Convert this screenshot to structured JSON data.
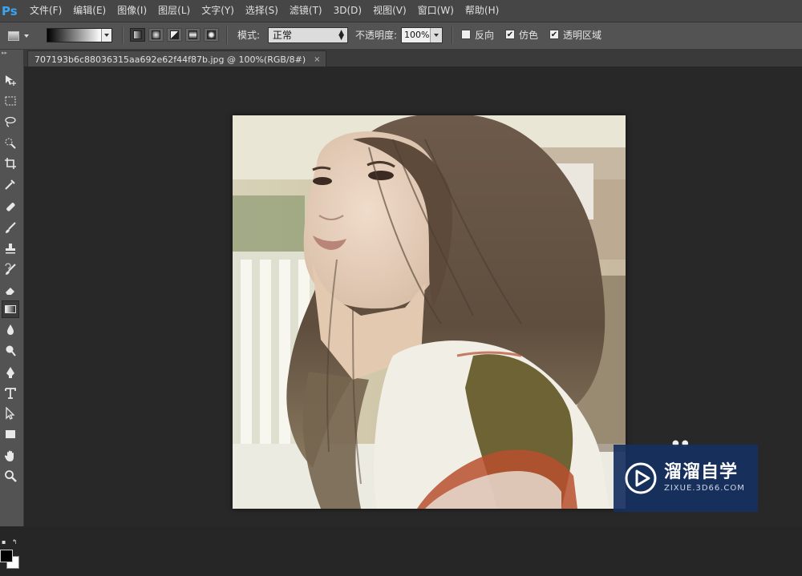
{
  "app": {
    "logo": "Ps"
  },
  "menu": [
    "文件(F)",
    "编辑(E)",
    "图像(I)",
    "图层(L)",
    "文字(Y)",
    "选择(S)",
    "滤镜(T)",
    "3D(D)",
    "视图(V)",
    "窗口(W)",
    "帮助(H)"
  ],
  "options": {
    "mode_label": "模式:",
    "mode_value": "正常",
    "opacity_label": "不透明度:",
    "opacity_value": "100%",
    "reverse_label": "反向",
    "reverse_checked": false,
    "dither_label": "仿色",
    "dither_checked": true,
    "transparency_label": "透明区域",
    "transparency_checked": true,
    "gradient_types": [
      "linear",
      "radial",
      "angle",
      "reflected",
      "diamond"
    ],
    "active_gradient_type": "linear"
  },
  "tools": [
    {
      "name": "move-tool-icon"
    },
    {
      "name": "marquee-tool-icon"
    },
    {
      "name": "lasso-tool-icon"
    },
    {
      "name": "quick-select-tool-icon"
    },
    {
      "name": "crop-tool-icon"
    },
    {
      "name": "eyedropper-tool-icon"
    },
    {
      "name": "healing-brush-tool-icon"
    },
    {
      "name": "brush-tool-icon"
    },
    {
      "name": "clone-stamp-tool-icon"
    },
    {
      "name": "history-brush-tool-icon"
    },
    {
      "name": "eraser-tool-icon"
    },
    {
      "name": "gradient-tool-icon",
      "active": true
    },
    {
      "name": "blur-tool-icon"
    },
    {
      "name": "dodge-tool-icon"
    },
    {
      "name": "pen-tool-icon"
    },
    {
      "name": "type-tool-icon"
    },
    {
      "name": "path-selection-tool-icon"
    },
    {
      "name": "rectangle-tool-icon"
    },
    {
      "name": "hand-tool-icon"
    },
    {
      "name": "zoom-tool-icon"
    }
  ],
  "colors": {
    "foreground": "#000000",
    "background": "#ffffff"
  },
  "document": {
    "tab_title": "707193b6c88036315aa692e62f44f87b.jpg @ 100%(RGB/8#)",
    "close_glyph": "×"
  },
  "watermark": {
    "title": "溜溜自学",
    "subtitle": "ZIXUE.3D66.COM",
    "color": "#163060"
  }
}
